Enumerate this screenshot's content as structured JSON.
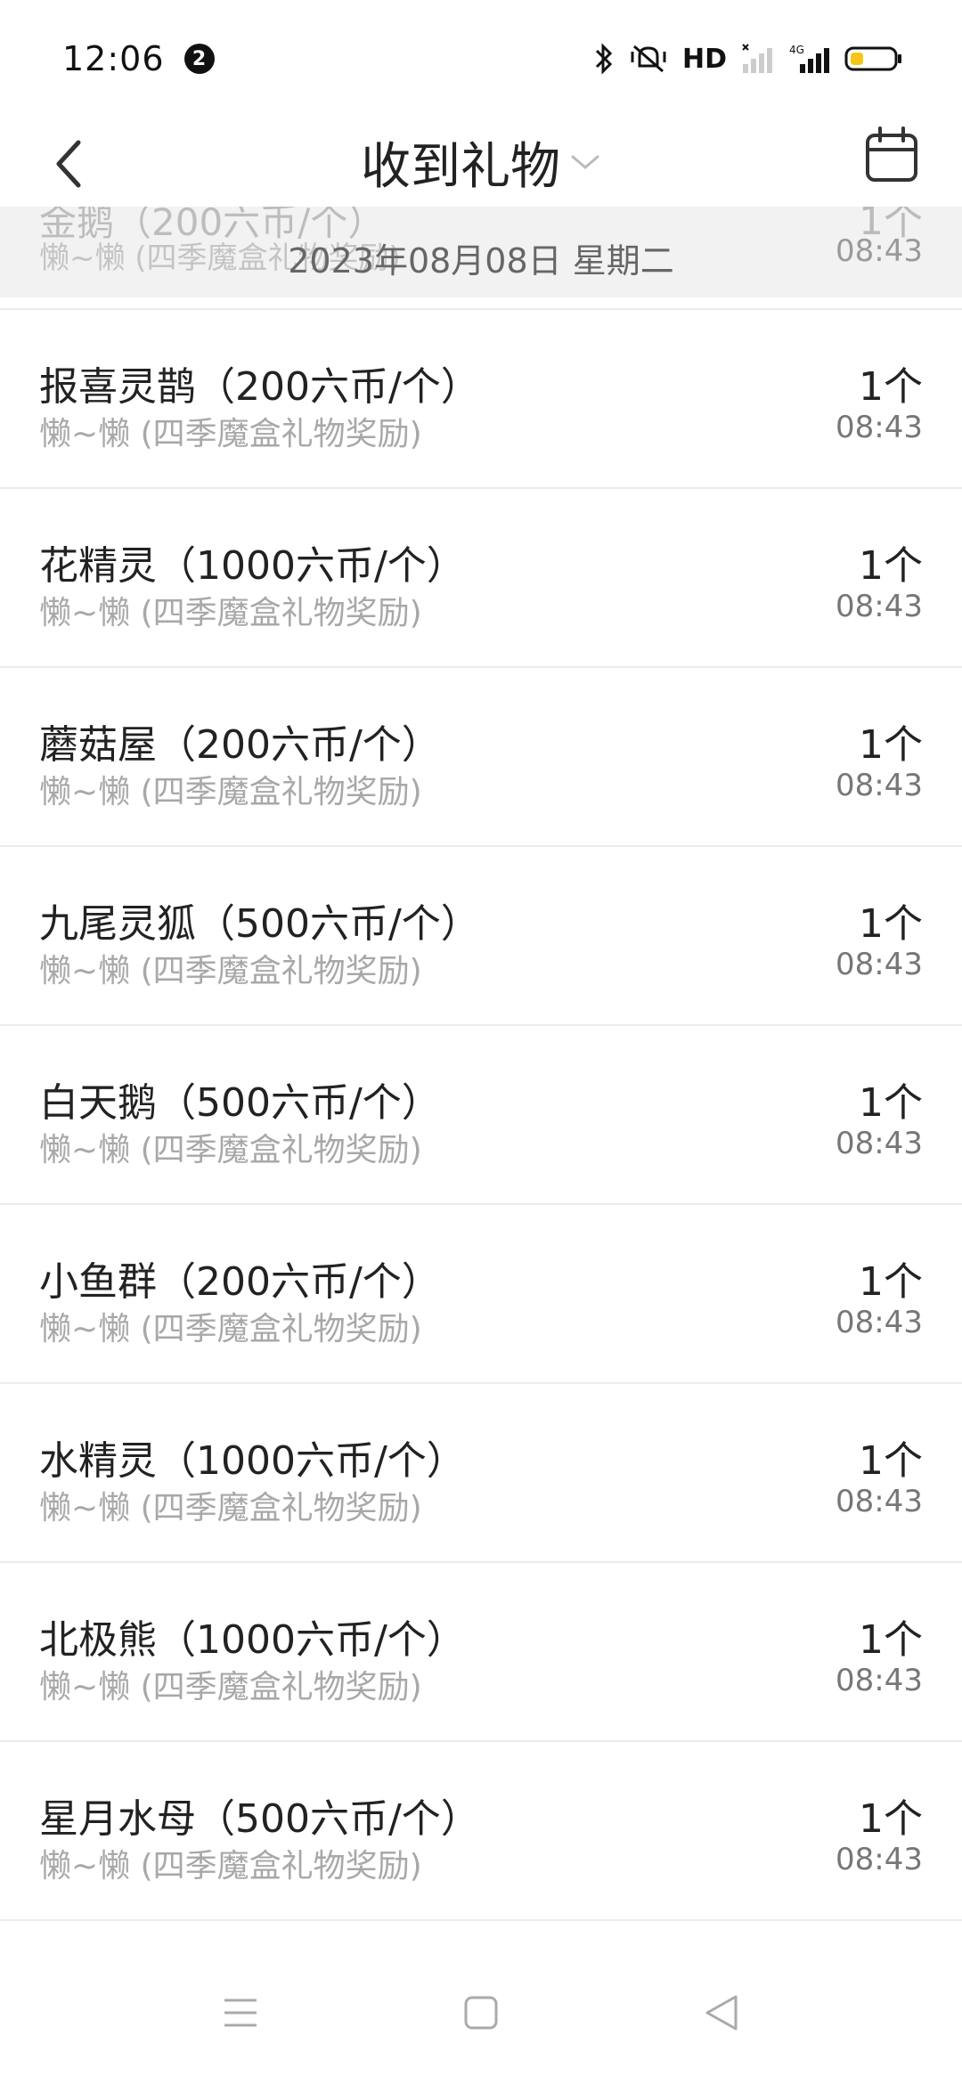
{
  "status_bar": {
    "time": "12:06",
    "notification_count": "2",
    "network_label": "HD",
    "network_type": "4G"
  },
  "header": {
    "title": "收到礼物"
  },
  "sticky_date": {
    "date_text": "2023年08月08日 星期二",
    "partial_item": {
      "name": "金鹅（200六币/个）",
      "sender": "懒~懒 (四季魔盒礼物奖励)",
      "quantity": "1个",
      "time": "08:43"
    }
  },
  "gifts": [
    {
      "name": "报喜灵鹊（200六币/个）",
      "sender": "懒~懒 (四季魔盒礼物奖励)",
      "quantity": "1个",
      "time": "08:43"
    },
    {
      "name": "花精灵（1000六币/个）",
      "sender": "懒~懒 (四季魔盒礼物奖励)",
      "quantity": "1个",
      "time": "08:43"
    },
    {
      "name": "蘑菇屋（200六币/个）",
      "sender": "懒~懒 (四季魔盒礼物奖励)",
      "quantity": "1个",
      "time": "08:43"
    },
    {
      "name": "九尾灵狐（500六币/个）",
      "sender": "懒~懒 (四季魔盒礼物奖励)",
      "quantity": "1个",
      "time": "08:43"
    },
    {
      "name": "白天鹅（500六币/个）",
      "sender": "懒~懒 (四季魔盒礼物奖励)",
      "quantity": "1个",
      "time": "08:43"
    },
    {
      "name": "小鱼群（200六币/个）",
      "sender": "懒~懒 (四季魔盒礼物奖励)",
      "quantity": "1个",
      "time": "08:43"
    },
    {
      "name": "水精灵（1000六币/个）",
      "sender": "懒~懒 (四季魔盒礼物奖励)",
      "quantity": "1个",
      "time": "08:43"
    },
    {
      "name": "北极熊（1000六币/个）",
      "sender": "懒~懒 (四季魔盒礼物奖励)",
      "quantity": "1个",
      "time": "08:43"
    },
    {
      "name": "星月水母（500六币/个）",
      "sender": "懒~懒 (四季魔盒礼物奖励)",
      "quantity": "1个",
      "time": "08:43"
    }
  ],
  "colors": {
    "battery_fill": "#f5c518",
    "sticky_bg": "#f2f2f2"
  }
}
